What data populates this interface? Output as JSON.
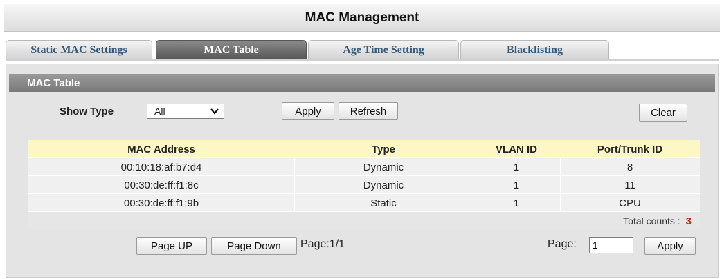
{
  "page": {
    "title": "MAC Management"
  },
  "tabs": [
    {
      "label": "Static MAC Settings"
    },
    {
      "label": "MAC Table"
    },
    {
      "label": "Age Time Setting"
    },
    {
      "label": "Blacklisting"
    }
  ],
  "panel": {
    "title": "MAC Table"
  },
  "filter": {
    "show_type_label": "Show Type",
    "show_type_value": "All",
    "apply_label": "Apply",
    "refresh_label": "Refresh",
    "clear_label": "Clear"
  },
  "table": {
    "columns": [
      "MAC Address",
      "Type",
      "VLAN ID",
      "Port/Trunk ID"
    ],
    "rows": [
      [
        "00:10:18:af:b7:d4",
        "Dynamic",
        "1",
        "8"
      ],
      [
        "00:30:de:ff:f1:8c",
        "Dynamic",
        "1",
        "11"
      ],
      [
        "00:30:de:ff:f1:9b",
        "Static",
        "1",
        "CPU"
      ]
    ],
    "total_label": "Total counts :",
    "total_value": "3"
  },
  "pagination": {
    "page_up_label": "Page UP",
    "page_down_label": "Page Down",
    "page_info": "Page:1/1",
    "page_label": "Page:",
    "page_input_value": "1",
    "apply_label": "Apply"
  }
}
